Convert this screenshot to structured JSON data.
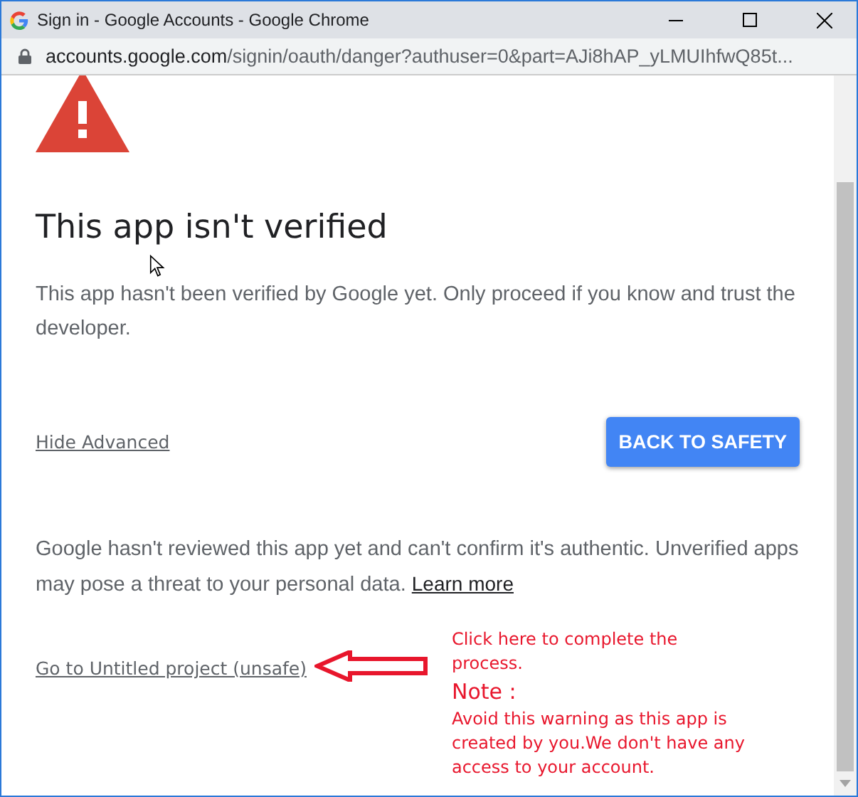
{
  "window": {
    "title": "Sign in - Google Accounts - Google Chrome"
  },
  "address_bar": {
    "domain": "accounts.google.com",
    "path": "/signin/oauth/danger?authuser=0&part=AJi8hAP_yLMUIhfwQ85t..."
  },
  "page": {
    "heading": "This app isn't verified",
    "description": "This app hasn't been verified by Google yet. Only proceed if you know and trust the developer.",
    "advanced_link": "Hide Advanced",
    "back_button": "BACK TO SAFETY",
    "warning": "Google hasn't reviewed this app yet and can't confirm it's authentic. Unverified apps may pose a threat to your personal data.",
    "learn_more": "Learn more",
    "unsafe_link": "Go to Untitled project (unsafe)"
  },
  "annotation": {
    "instruction": "Click here to complete the process.",
    "note_title": "Note :",
    "note": "Avoid this warning as this app is created by you.We don't have any access to your account."
  }
}
